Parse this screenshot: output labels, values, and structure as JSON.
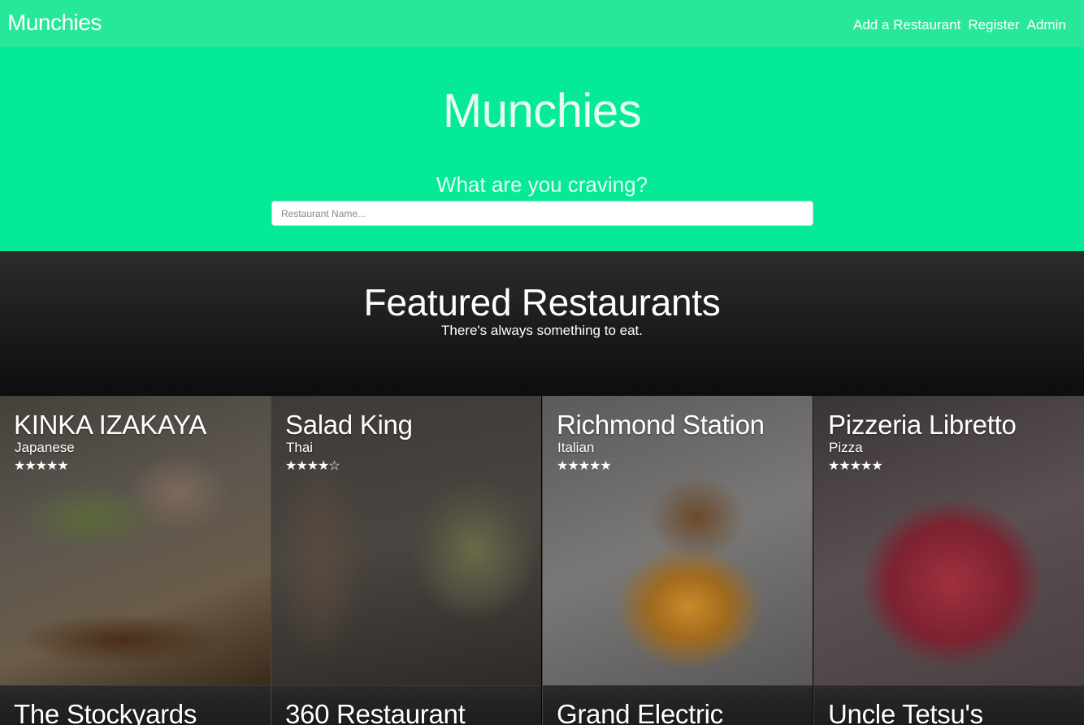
{
  "nav": {
    "brand": "Munchies",
    "links": [
      "Add a Restaurant",
      "Register",
      "Admin"
    ]
  },
  "hero": {
    "title": "Munchies",
    "subtitle": "What are you craving?",
    "search_placeholder": "Restaurant Name..."
  },
  "featured": {
    "title": "Featured Restaurants",
    "subtitle": "There's always something to eat."
  },
  "restaurants": [
    {
      "name": "KINKA IZAKAYA",
      "category": "Japanese",
      "stars": "★★★★★",
      "rating": 5
    },
    {
      "name": "Salad King",
      "category": "Thai",
      "stars": "★★★★☆",
      "rating": 4
    },
    {
      "name": "Richmond Station",
      "category": "Italian",
      "stars": "★★★★★",
      "rating": 5
    },
    {
      "name": "Pizzeria Libretto",
      "category": "Pizza",
      "stars": "★★★★★",
      "rating": 5
    },
    {
      "name": "The Stockyards"
    },
    {
      "name": "360 Restaurant"
    },
    {
      "name": "Grand Electric"
    },
    {
      "name": "Uncle Tetsu's"
    }
  ]
}
